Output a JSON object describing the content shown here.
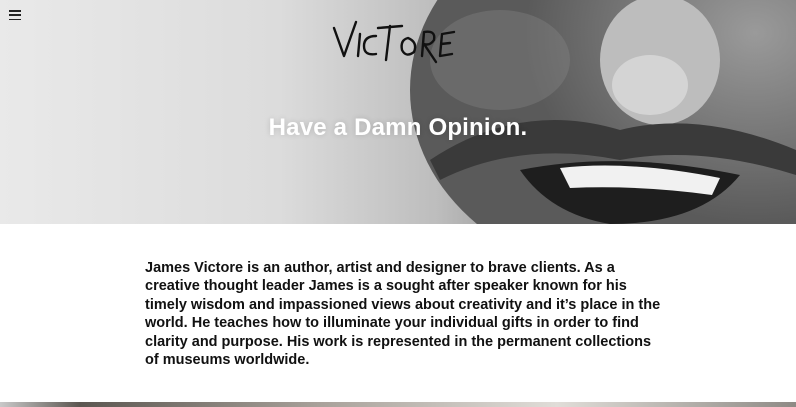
{
  "header": {
    "menu_icon": "hamburger-menu-icon",
    "logo_text": "VICTORE"
  },
  "hero": {
    "headline": "Have a Damn Opinion."
  },
  "about": {
    "bio": "James Victore is an author, artist and designer to brave clients. As a creative thought leader James is a sought after speaker known for his timely wisdom and impassioned views about creativity and it’s place in the world. He teaches how to illuminate your individual gifts in order to find clarity and purpose. His work is represented in the permanent collections of museums worldwide."
  },
  "colors": {
    "text": "#111111",
    "hero_text": "#ffffff",
    "background": "#ffffff"
  }
}
